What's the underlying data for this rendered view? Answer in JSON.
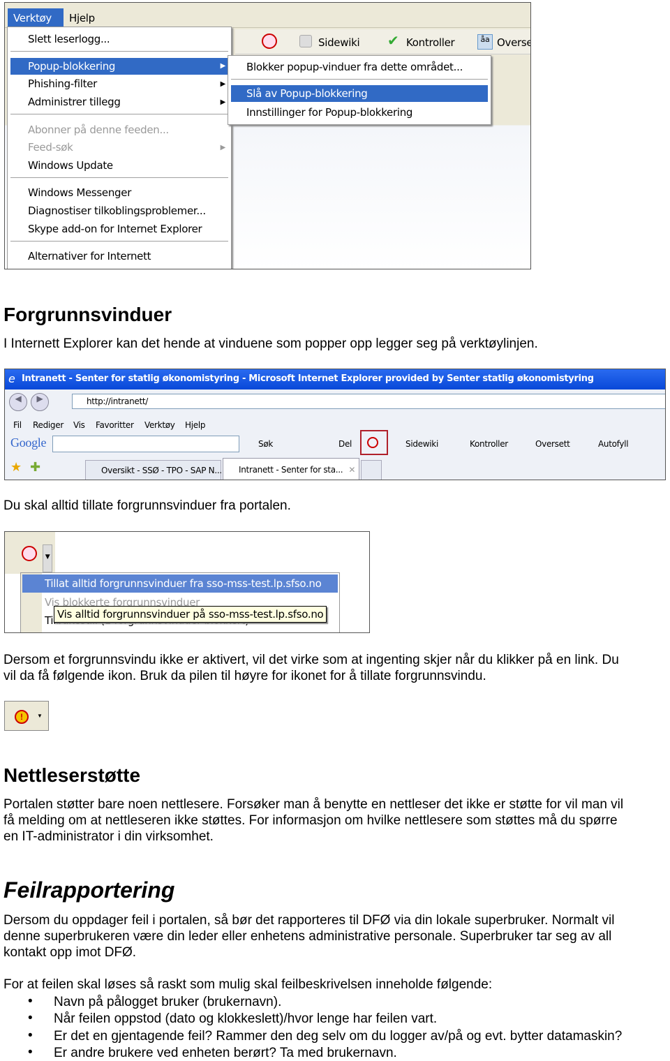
{
  "shot1": {
    "menubar": [
      "Verktøy",
      "Hjelp"
    ],
    "toolbar": [
      "Sidewiki",
      "Kontroller",
      "Overse"
    ],
    "menu": [
      {
        "label": "Slett leserlogg..."
      },
      {
        "label": "Popup-blokkering",
        "submenu": true,
        "highlighted": true
      },
      {
        "label": "Phishing-filter",
        "submenu": true
      },
      {
        "label": "Administrer tillegg",
        "submenu": true
      },
      {
        "label": "Abonner på denne feeden...",
        "disabled": true
      },
      {
        "label": "Feed-søk",
        "submenu": true,
        "disabled": true
      },
      {
        "label": "Windows Update"
      },
      {
        "label": "Windows Messenger"
      },
      {
        "label": "Diagnostiser tilkoblingsproblemer..."
      },
      {
        "label": "Skype add-on for Internet Explorer"
      },
      {
        "label": "Alternativer for Internett"
      }
    ],
    "submenu": [
      {
        "label": "Blokker popup-vinduer fra dette området..."
      },
      {
        "label": "Slå av Popup-blokkering",
        "highlighted": true
      },
      {
        "label": "Innstillinger for Popup-blokkering"
      }
    ]
  },
  "section1": {
    "title": "Forgrunnsvinduer",
    "p1": "I Internett Explorer kan det hende at vinduene som popper opp legger seg på verktøylinjen."
  },
  "shot2": {
    "title": "Intranett - Senter for statlig økonomistyring - Microsoft Internet Explorer provided by Senter statlig økonomistyring",
    "address": "http://intranett/",
    "menu": [
      "Fil",
      "Rediger",
      "Vis",
      "Favoritter",
      "Verktøy",
      "Hjelp"
    ],
    "google": "Google",
    "toolbar": [
      "Søk",
      "Del",
      "Sidewiki",
      "Kontroller",
      "Oversett",
      "Autofyll"
    ],
    "tabs": [
      "Oversikt - SSØ - TPO - SAP N...",
      "Intranett - Senter for sta..."
    ],
    "highlight_color": "#b0202a"
  },
  "p2": "Du skal alltid tillate forgrunnsvinduer fra portalen.",
  "shot3": {
    "items": [
      {
        "label": "Tillat alltid forgrunnsvinduer fra sso-mss-test.lp.sfso.no",
        "highlighted": true
      },
      {
        "label": "Vis blokkerte forgrunnsvinduer",
        "disabled": true
      },
      {
        "label": "Tilbakestill (1 forgrunnsvinduer blokkert)"
      }
    ],
    "tooltip": "Vis alltid forgrunnsvinduer på sso-mss-test.lp.sfso.no"
  },
  "p3": [
    "Dersom et forgrunnsvindu ikke er aktivert, vil det virke som at ingenting skjer når du klikker på en link. Du",
    "vil da få følgende ikon. Bruk da pilen til høyre for ikonet for å tillate forgrunnsvindu."
  ],
  "section2": {
    "title": "Nettleserstøtte",
    "lines": [
      "Portalen støtter bare noen nettlesere. Forsøker man å benytte en nettleser det ikke er støtte for vil man vil",
      "få melding om at nettleseren ikke støttes. For informasjon om hvilke nettlesere som støttes må du spørre",
      "en IT-administrator i din virksomhet."
    ]
  },
  "section3": {
    "title": "Feilrapportering",
    "lines": [
      "Dersom du oppdager feil i portalen, så bør det rapporteres til DFØ via din lokale superbruker. Normalt vil",
      "denne superbrukeren være din leder eller enhetens administrative personale. Superbruker tar seg av all",
      "kontakt opp imot DFØ."
    ],
    "intro": "For at feilen skal løses så raskt som mulig skal feilbeskrivelsen inneholde følgende:",
    "bullets": [
      "Navn på pålogget bruker (brukernavn).",
      "Når feilen oppstod (dato og klokkeslett)/hvor lenge har feilen vart.",
      "Er det en gjentagende feil? Rammer den deg selv om du logger av/på og evt. bytter datamaskin?",
      "Er andre brukere ved enheten berørt? Ta med brukernavn."
    ]
  }
}
